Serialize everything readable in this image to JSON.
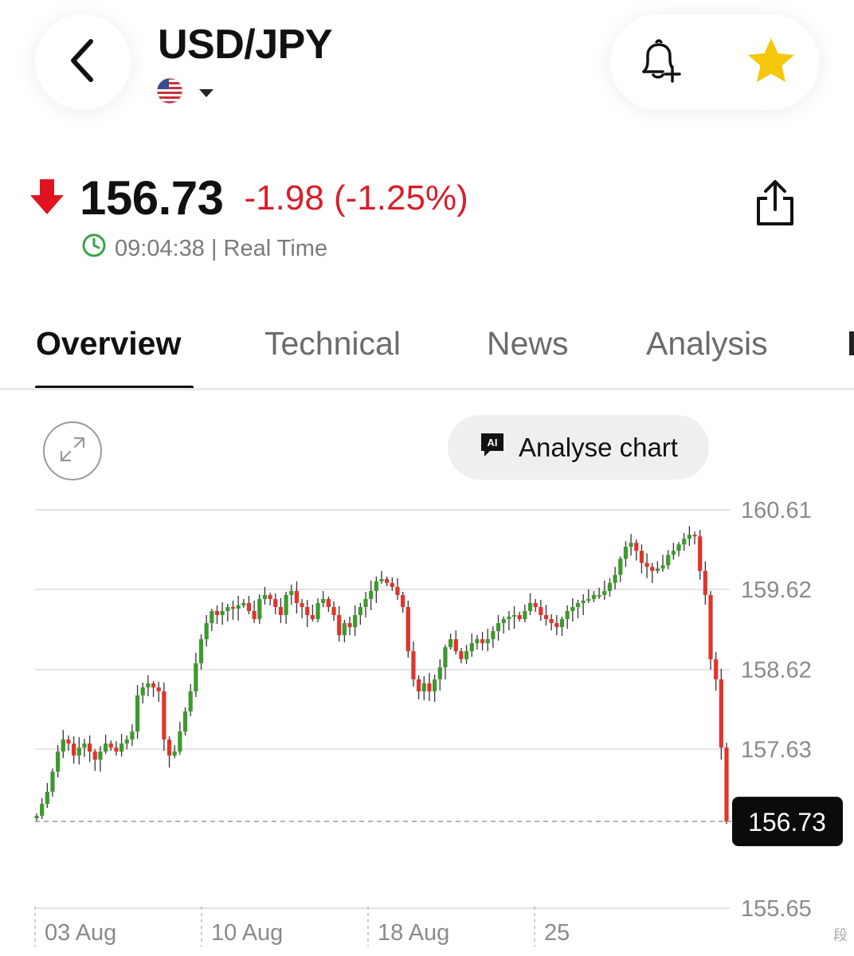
{
  "header": {
    "title": "USD/JPY"
  },
  "quote": {
    "price": "156.73",
    "change": "-1.98 (-1.25%)",
    "time": "09:04:38 | Real Time"
  },
  "tabs": [
    {
      "label": "Overview",
      "active": true
    },
    {
      "label": "Technical",
      "active": false
    },
    {
      "label": "News",
      "active": false
    },
    {
      "label": "Analysis",
      "active": false
    }
  ],
  "chart_tools": {
    "analyse_label": "Analyse chart",
    "ai_badge": "AI"
  },
  "colors": {
    "up": "#3c9a2d",
    "down": "#e0342b",
    "change_text": "#d91e2a",
    "star": "#f6c60a",
    "clock": "#3aa24a"
  },
  "icons": [
    "back-arrow-icon",
    "us-flag-icon",
    "bell-plus-icon",
    "star-icon",
    "down-arrow-icon",
    "clock-icon",
    "share-icon",
    "expand-icon",
    "ai-chat-icon"
  ],
  "chart_data": {
    "type": "candlestick",
    "ylim": [
      155.65,
      160.61
    ],
    "y_ticks": [
      "160.61",
      "159.62",
      "158.62",
      "157.63",
      "155.65"
    ],
    "x_ticks": [
      "03 Aug",
      "10 Aug",
      "18 Aug",
      "25"
    ],
    "last_price_label": "156.73",
    "last_price": 156.73,
    "grid": true,
    "close_path": [
      156.8,
      156.95,
      157.1,
      157.35,
      157.6,
      157.75,
      157.7,
      157.55,
      157.65,
      157.7,
      157.6,
      157.5,
      157.6,
      157.7,
      157.65,
      157.6,
      157.7,
      157.75,
      157.85,
      158.3,
      158.4,
      158.45,
      158.4,
      158.35,
      157.75,
      157.55,
      157.6,
      157.85,
      158.1,
      158.35,
      158.7,
      159.0,
      159.2,
      159.35,
      159.3,
      159.35,
      159.4,
      159.38,
      159.42,
      159.45,
      159.35,
      159.25,
      159.5,
      159.55,
      159.5,
      159.4,
      159.3,
      159.55,
      159.6,
      159.45,
      159.4,
      159.3,
      159.25,
      159.45,
      159.5,
      159.4,
      159.3,
      159.05,
      159.2,
      159.15,
      159.3,
      159.4,
      159.5,
      159.6,
      159.72,
      159.75,
      159.7,
      159.65,
      159.55,
      159.4,
      158.85,
      158.5,
      158.35,
      158.45,
      158.35,
      158.5,
      158.65,
      158.9,
      159.0,
      158.85,
      158.75,
      158.85,
      158.95,
      159.0,
      158.95,
      159.0,
      159.1,
      159.2,
      159.25,
      159.28,
      159.3,
      159.25,
      159.35,
      159.45,
      159.4,
      159.3,
      159.25,
      159.2,
      159.15,
      159.25,
      159.35,
      159.4,
      159.45,
      159.48,
      159.5,
      159.55,
      159.55,
      159.6,
      159.7,
      159.8,
      160.0,
      160.15,
      160.2,
      160.1,
      159.95,
      159.9,
      159.85,
      159.88,
      159.92,
      160.05,
      160.1,
      160.18,
      160.25,
      160.3,
      160.28,
      159.85,
      159.55,
      158.75,
      158.5,
      157.65,
      156.73
    ]
  }
}
